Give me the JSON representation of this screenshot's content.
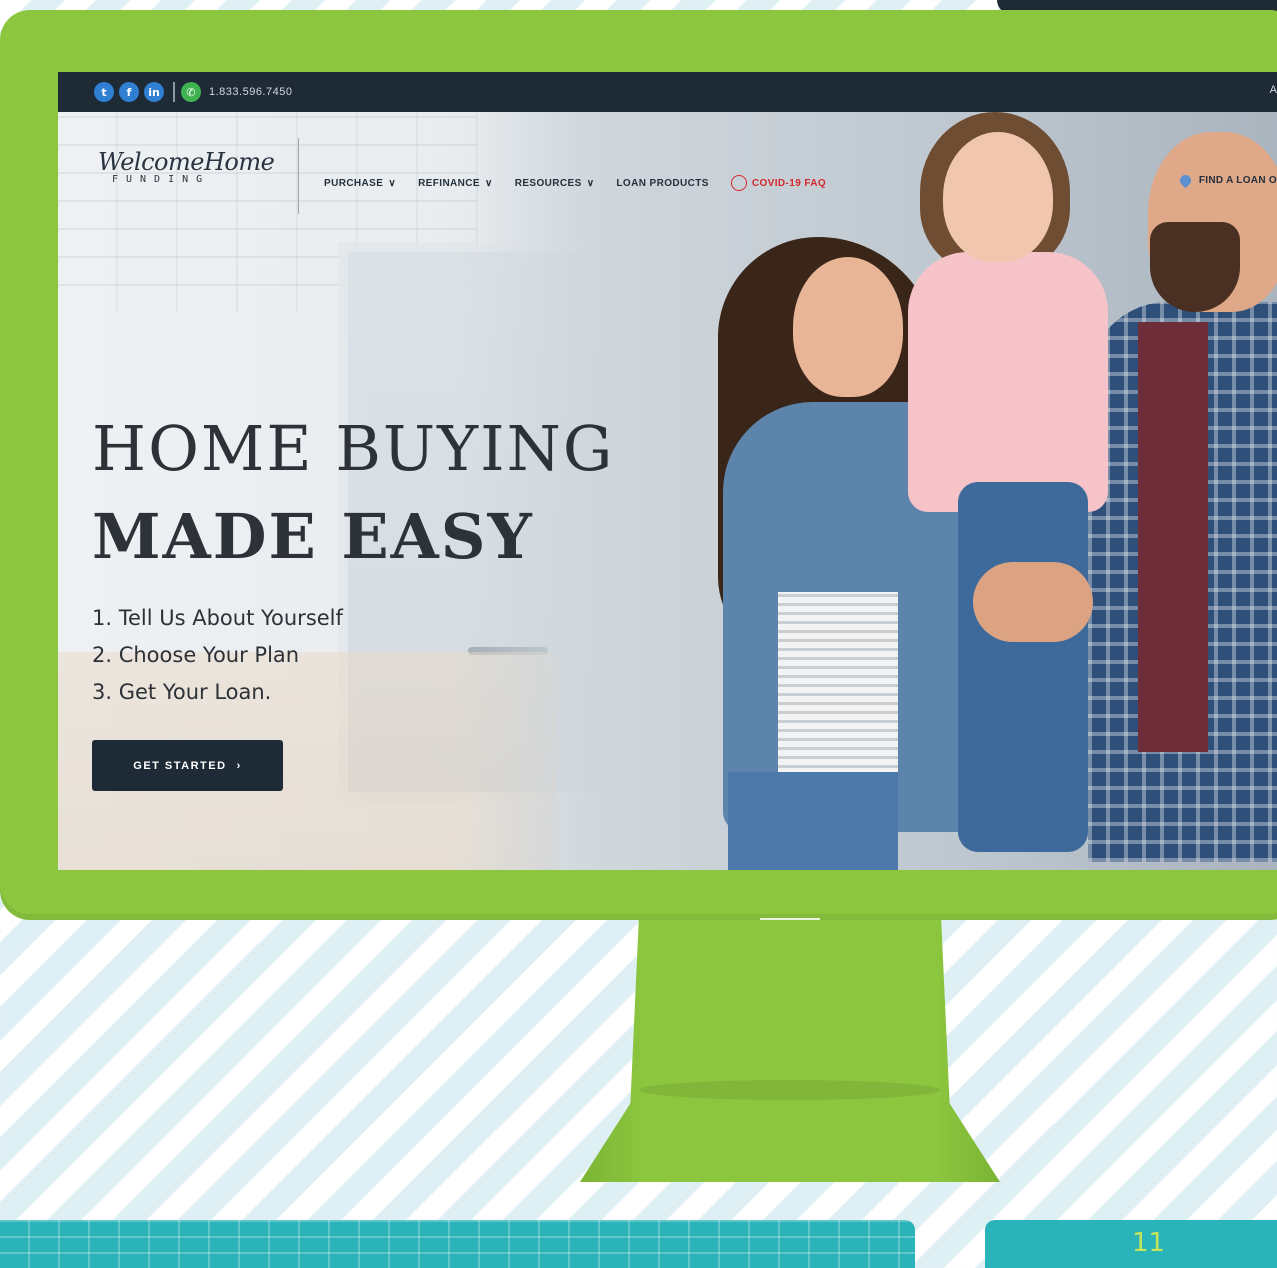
{
  "topbar": {
    "social_icons": [
      "twitter-icon",
      "facebook-icon",
      "linkedin-icon"
    ],
    "social_glyphs": [
      "t",
      "f",
      "in"
    ],
    "phone": "1.833.596.7450",
    "right_text": "A"
  },
  "logo": {
    "script": "WelcomeHome",
    "sub": "FUNDING"
  },
  "nav": {
    "items": [
      {
        "label": "PURCHASE",
        "dropdown": true
      },
      {
        "label": "REFINANCE",
        "dropdown": true
      },
      {
        "label": "RESOURCES",
        "dropdown": true
      },
      {
        "label": "LOAN PRODUCTS",
        "dropdown": false
      }
    ],
    "covid_label": "COVID-19 FAQ",
    "find_loan_label": "FIND A LOAN O"
  },
  "hero": {
    "title_line1": "HOME BUYING",
    "title_line2": "MADE EASY",
    "steps": [
      "1. Tell Us About Yourself",
      "2. Choose Your Plan",
      "3. Get Your Loan."
    ],
    "cta_label": "GET STARTED",
    "cta_chevron": "›"
  },
  "page_number": "11",
  "colors": {
    "monitor": "#8cc63f",
    "topbar": "#1e2a35",
    "keyboard": "#2ab3b8",
    "covid": "#d6272c"
  }
}
